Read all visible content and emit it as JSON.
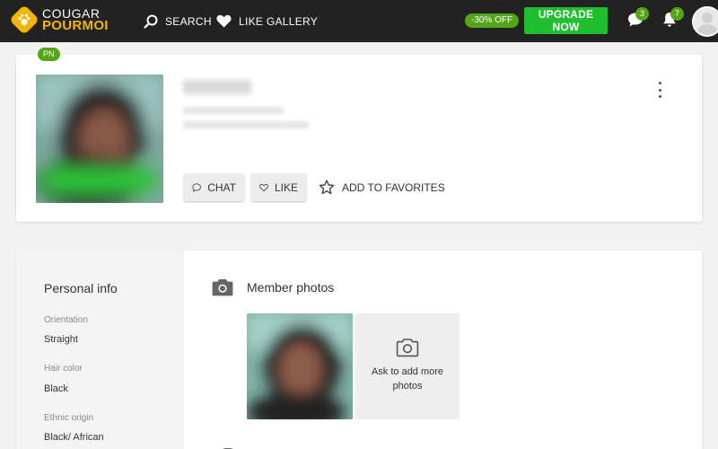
{
  "brand": {
    "line1": "COUGAR",
    "line2": "POURMOI"
  },
  "nav": {
    "search": "SEARCH",
    "like_gallery": "LIKE GALLERY"
  },
  "promo": {
    "discount": "-30% OFF",
    "upgrade": "UPGRADE NOW"
  },
  "notifications": {
    "chat_count": "3",
    "bell_count": "7"
  },
  "profile": {
    "badge": "PN",
    "actions": {
      "chat": "CHAT",
      "like": "LIKE",
      "favorites": "ADD TO FAVORITES"
    }
  },
  "personal_info": {
    "title": "Personal info",
    "fields": [
      {
        "label": "Orientation",
        "value": "Straight"
      },
      {
        "label": "Hair color",
        "value": "Black"
      },
      {
        "label": "Ethnic origin",
        "value": "Black/ African"
      }
    ]
  },
  "photos": {
    "title": "Member photos",
    "ask_more": "Ask to add more photos"
  },
  "colors": {
    "accent_green": "#52a617",
    "upgrade_green": "#1fbf2d",
    "brand_yellow": "#f4b400",
    "topbar": "#222222"
  }
}
